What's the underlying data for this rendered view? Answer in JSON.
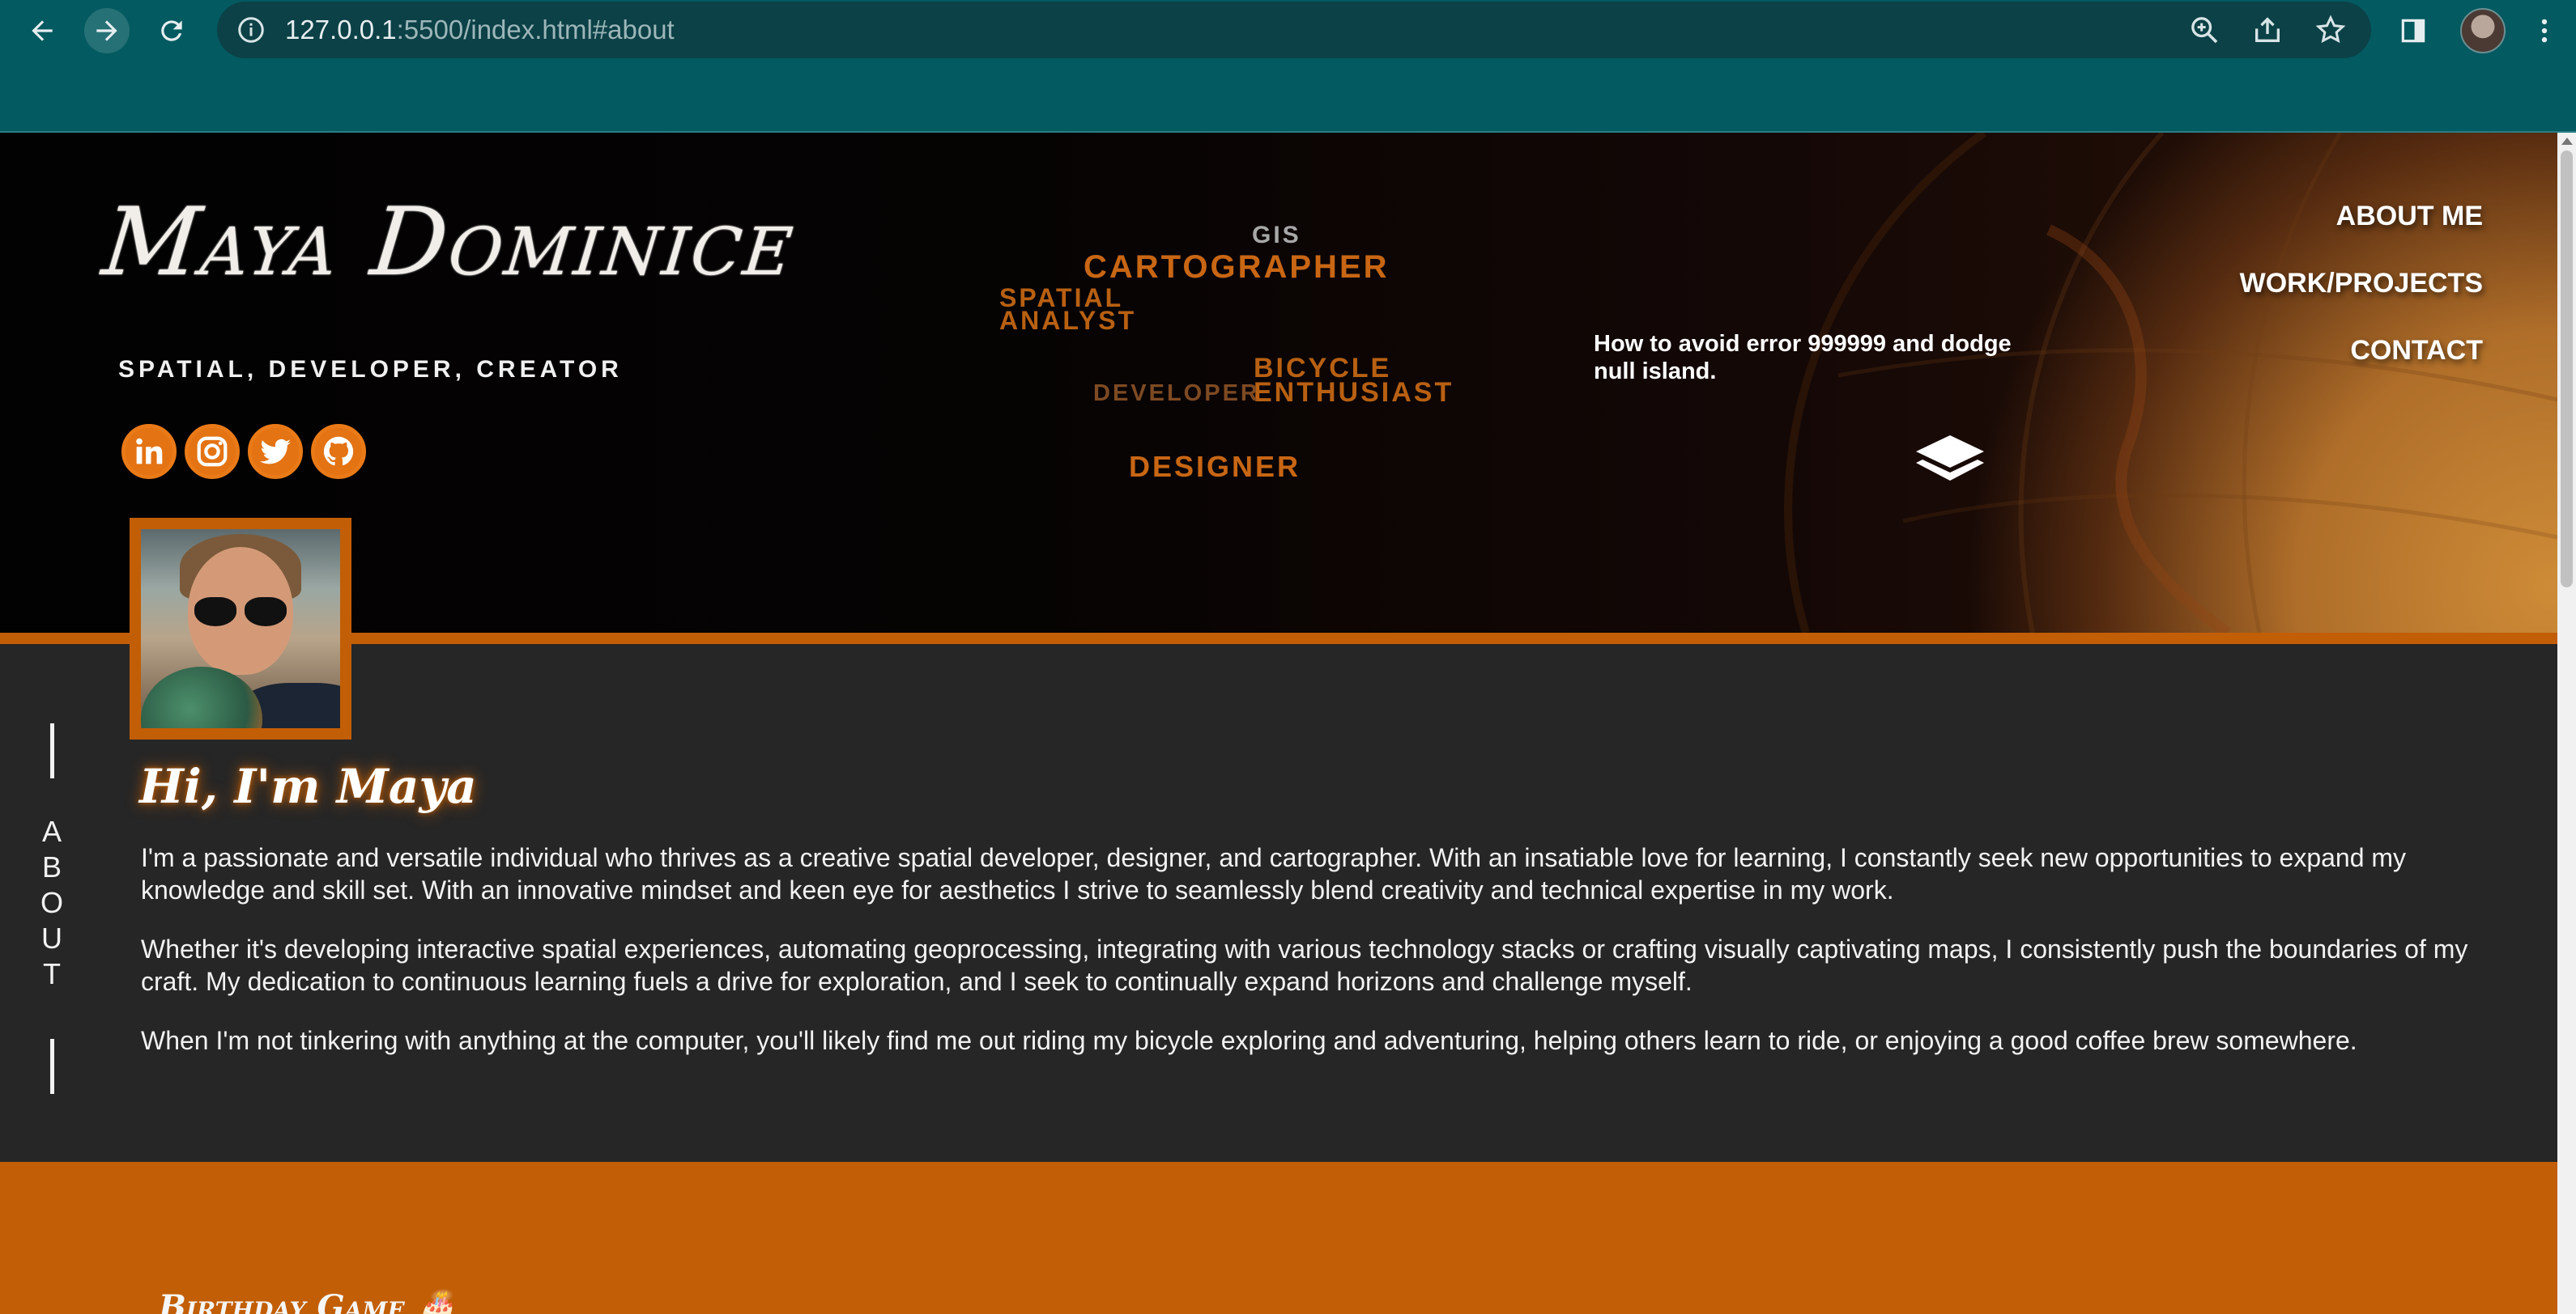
{
  "browser": {
    "url_host": "127.0.0.1",
    "url_rest": ":5500/index.html#about"
  },
  "site": {
    "brand": "Maya Dominice",
    "tagline": "SPATIAL, DEVELOPER, CREATOR",
    "socials": [
      "linkedin-icon",
      "instagram-icon",
      "twitter-icon",
      "github-icon"
    ],
    "word_cloud": {
      "gis": "GIS",
      "cartographer": "CARTOGRAPHER",
      "spatial": "SPATIAL",
      "analyst": "ANALYST",
      "bicycle": "BICYCLE",
      "enthusiast": "ENTHUSIAST",
      "developer": "DEVELOPER",
      "designer": "DESIGNER"
    },
    "tip": "How to avoid error 999999 and dodge null island.",
    "nav": [
      "ABOUT ME",
      "WORK/PROJECTS",
      "CONTACT"
    ],
    "side_label": "ABOUT"
  },
  "about": {
    "title": "Hi, I'm Maya",
    "paragraphs": [
      "I'm a passionate and versatile individual who thrives as a creative spatial developer, designer, and cartographer. With an insatiable love for learning, I constantly seek new opportunities to expand my knowledge and skill set. With an innovative mindset and keen eye for aesthetics I strive to seamlessly blend creativity and technical expertise in my work.",
      "Whether it's developing interactive spatial experiences, automating geoprocessing, integrating with various technology stacks or crafting visually captivating maps, I consistently push the boundaries of my craft. My dedication to continuous learning fuels a drive for exploration, and I seek to continually expand horizons and challenge myself.",
      "When I'm not tinkering with anything at the computer, you'll likely find me out riding my bicycle exploring and adventuring, helping others learn to ride, or enjoying a good coffee brew somewhere."
    ]
  },
  "next_section": {
    "title": "Birthday Game 🎂"
  },
  "colors": {
    "accent": "#c25e06",
    "chrome": "#035a60",
    "page_bg": "#262626"
  }
}
